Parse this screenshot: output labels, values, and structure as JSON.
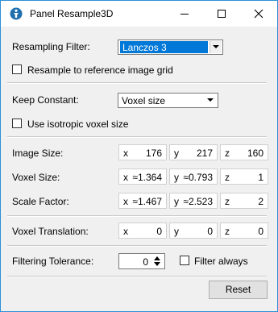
{
  "window": {
    "title": "Panel Resample3D"
  },
  "resampling_filter": {
    "label": "Resampling Filter:",
    "value": "Lanczos 3"
  },
  "resample_reference": {
    "label": "Resample to reference image grid",
    "checked": false
  },
  "keep_constant": {
    "label": "Keep Constant:",
    "value": "Voxel size"
  },
  "isotropic": {
    "label": "Use isotropic voxel size",
    "checked": false
  },
  "image_size": {
    "label": "Image Size:",
    "x": "176",
    "y": "217",
    "z": "160"
  },
  "voxel_size": {
    "label": "Voxel Size:",
    "x": "≈1.364",
    "y": "≈0.793",
    "z": "1"
  },
  "scale_factor": {
    "label": "Scale Factor:",
    "x": "≈1.467",
    "y": "≈2.523",
    "z": "2"
  },
  "voxel_translation": {
    "label": "Voxel Translation:",
    "x": "0",
    "y": "0",
    "z": "0"
  },
  "filtering_tolerance": {
    "label": "Filtering Tolerance:",
    "value": "0"
  },
  "filter_always": {
    "label": "Filter always",
    "checked": false
  },
  "axes": {
    "x": "x",
    "y": "y",
    "z": "z"
  },
  "reset": {
    "label": "Reset"
  }
}
